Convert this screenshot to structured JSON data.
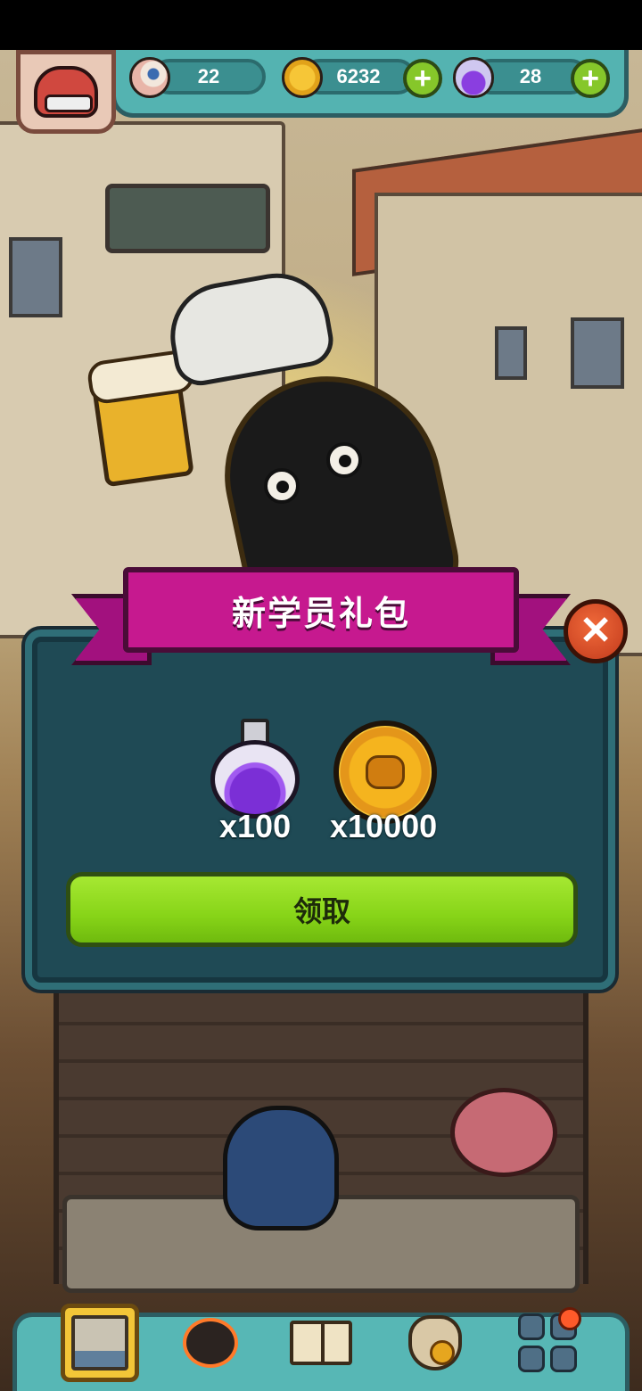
{
  "hud": {
    "eyeballs": {
      "icon": "eyeball-icon",
      "value": "22"
    },
    "coins": {
      "icon": "gold-coin-icon",
      "value": "6232",
      "add_icon": "plus-icon"
    },
    "potions": {
      "icon": "purple-potion-icon",
      "value": "28",
      "add_icon": "plus-icon"
    },
    "avatar_icon": "monster-avatar-icon"
  },
  "modal": {
    "title": "新学员礼包",
    "close_icon": "close-icon",
    "rewards": [
      {
        "icon": "purple-potion-icon",
        "quantity": "x100"
      },
      {
        "icon": "gold-coin-icon",
        "quantity": "x10000"
      }
    ],
    "claim_label": "领取"
  },
  "bottom_nav": [
    {
      "icon": "building-icon",
      "active": true
    },
    {
      "icon": "furball-monster-icon",
      "active": false
    },
    {
      "icon": "book-icon",
      "active": false
    },
    {
      "icon": "coin-bag-icon",
      "active": false
    },
    {
      "icon": "grid-menu-icon",
      "active": false,
      "badge": true
    }
  ],
  "colors": {
    "ribbon": "#c6198f",
    "claim_button": "#87d418",
    "hud_teal": "#54b3b1",
    "modal_bg": "#1f4a55",
    "close_button": "#d9482a"
  }
}
